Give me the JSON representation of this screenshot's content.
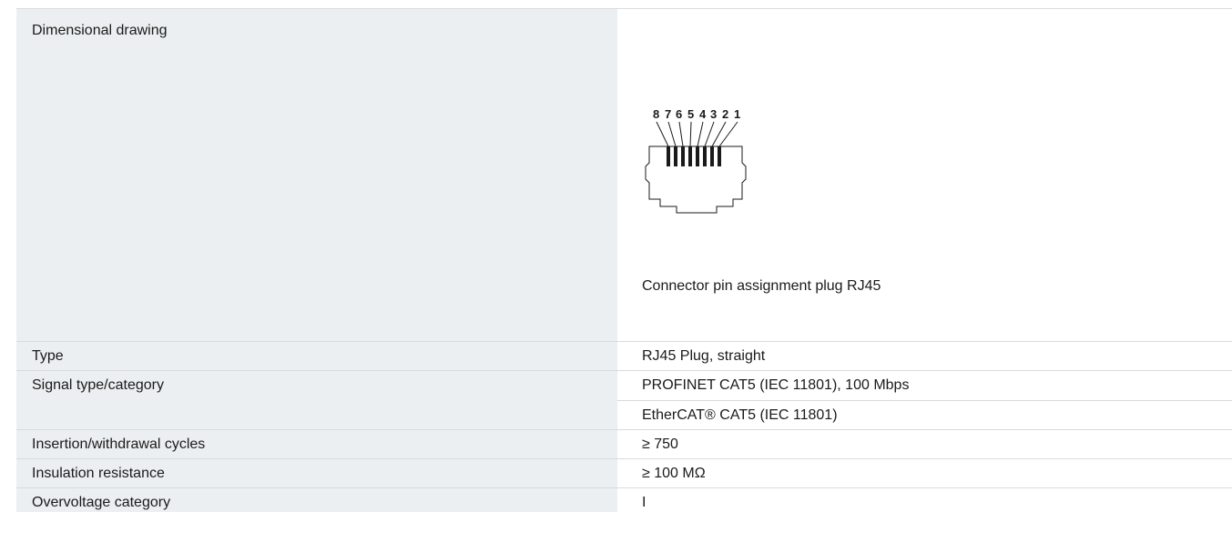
{
  "spec_table": {
    "drawing_row": {
      "label": "Dimensional drawing",
      "pin_numbers": [
        "8",
        "7",
        "6",
        "5",
        "4",
        "3",
        "2",
        "1"
      ],
      "caption": "Connector pin assignment plug RJ45"
    },
    "type_row": {
      "label": "Type",
      "value": "RJ45 Plug, straight"
    },
    "signal_row": {
      "label": "Signal type/category",
      "values": [
        "PROFINET CAT5 (IEC 11801), 100 Mbps",
        "EtherCAT® CAT5 (IEC 11801)"
      ]
    },
    "cycles_row": {
      "label": "Insertion/withdrawal cycles",
      "value": "≥ 750"
    },
    "insulation_row": {
      "label": "Insulation resistance",
      "value": "≥ 100 MΩ"
    },
    "overvoltage_row": {
      "label": "Overvoltage category",
      "value": "I"
    }
  },
  "colors": {
    "label_background": "#eceff1",
    "border": "#d7dbde",
    "text": "#1a1a1a"
  }
}
